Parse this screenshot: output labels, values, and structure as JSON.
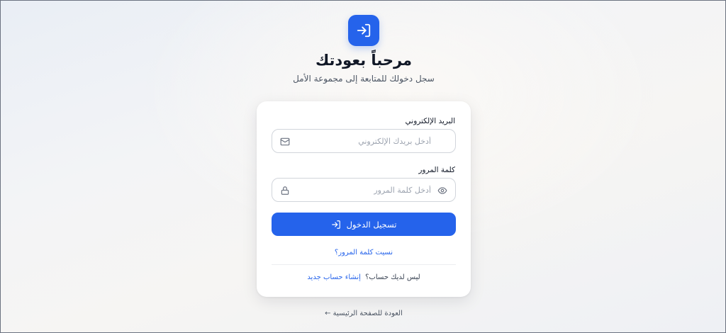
{
  "header": {
    "logo_icon": "login-icon",
    "title": "مرحباً بعودتك",
    "subtitle": "سجل دخولك للمتابعة إلى مجموعة الأمل"
  },
  "form": {
    "email": {
      "label": "البريد الإلكتروني",
      "placeholder": "أدخل بريدك الإلكتروني",
      "value": "",
      "icon": "mail-icon"
    },
    "password": {
      "label": "كلمة المرور",
      "placeholder": "أدخل كلمة المرور",
      "value": "",
      "lock_icon": "lock-icon",
      "toggle_icon": "eye-icon"
    },
    "submit_label": "تسجيل الدخول",
    "submit_icon": "login-icon",
    "forgot_label": "نسيت كلمة المرور؟",
    "signup_prompt": "ليس لديك حساب؟",
    "signup_link": "إنشاء حساب جديد"
  },
  "footer": {
    "back_arrow": "←",
    "back_label": "العودة للصفحة الرئيسية"
  },
  "colors": {
    "primary": "#2563eb",
    "text": "#111827",
    "muted": "#4b5563",
    "border": "#d1d5db"
  }
}
